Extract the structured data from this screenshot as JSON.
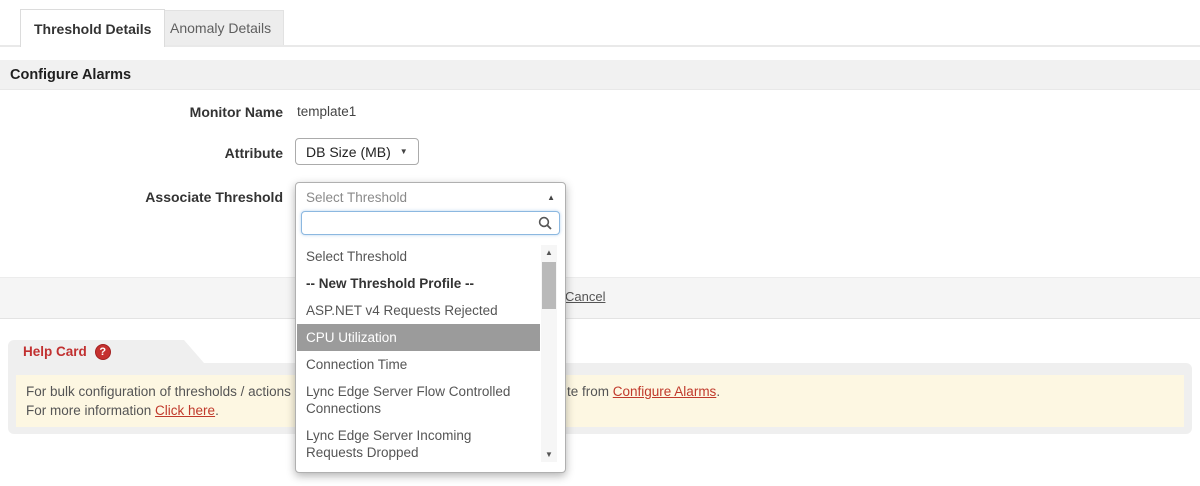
{
  "tabs": [
    {
      "label": "Threshold Details",
      "active": true
    },
    {
      "label": "Anomaly Details",
      "active": false
    }
  ],
  "section_header": "Configure Alarms",
  "form": {
    "monitor_name_label": "Monitor Name",
    "monitor_name_value": "template1",
    "attribute_label": "Attribute",
    "attribute_value": "DB Size (MB)",
    "attribute_caret": "▼",
    "associate_threshold_label": "Associate Threshold"
  },
  "dropdown": {
    "selected_label": "Select Threshold",
    "collapse_caret": "▲",
    "search_value": "",
    "items": [
      {
        "label": "Select Threshold"
      },
      {
        "label": "-- New Threshold Profile --"
      },
      {
        "label": "ASP.NET v4 Requests Rejected"
      },
      {
        "label": "CPU Utilization"
      },
      {
        "label": "Connection Time"
      },
      {
        "label": "Lync Edge Server Flow Controlled Connections"
      },
      {
        "label": "Lync Edge Server Incoming Requests Dropped"
      }
    ],
    "scroll_up_arrow": "▲",
    "scroll_down_arrow": "▼"
  },
  "actions": {
    "cancel_label": "Cancel"
  },
  "help_card": {
    "title": "Help Card",
    "badge": "?",
    "line1_left": "For bulk configuration of thresholds / actions",
    "line1_right_prefix": "te from ",
    "line1_link": "Configure Alarms",
    "line1_suffix": ".",
    "line2_prefix": "For more information ",
    "line2_link": "Click here",
    "line2_suffix": "."
  },
  "colors": {
    "accent_red": "#c13030",
    "highlight_gray": "#9b9b9b",
    "help_yellow_bg": "#fdf7e2",
    "panel_gray": "#efefef",
    "search_focus_border": "#8cb8e0"
  }
}
